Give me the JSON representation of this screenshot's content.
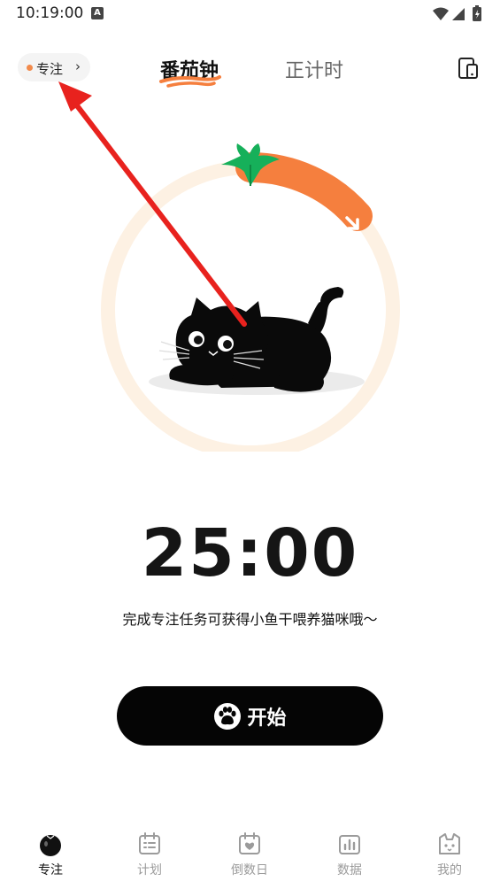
{
  "status": {
    "time": "10:19:00",
    "notice_letter": "A"
  },
  "header": {
    "focus_chip": "专注",
    "tabs": [
      {
        "label": "番茄钟",
        "active": true
      },
      {
        "label": "正计时",
        "active": false
      }
    ]
  },
  "timer": {
    "value": "25:00",
    "hint": "完成专注任务可获得小鱼干喂养猫咪哦～",
    "progress_fraction": 0.18
  },
  "actions": {
    "start_label": "开始"
  },
  "bottom_nav": [
    {
      "label": "专注",
      "icon": "tomato-icon",
      "active": true
    },
    {
      "label": "计划",
      "icon": "calendar-list-icon",
      "active": false
    },
    {
      "label": "倒数日",
      "icon": "calendar-heart-icon",
      "active": false
    },
    {
      "label": "数据",
      "icon": "bar-chart-icon",
      "active": false
    },
    {
      "label": "我的",
      "icon": "cat-face-icon",
      "active": false
    }
  ],
  "colors": {
    "accent_orange": "#f57f3e",
    "ring_bg": "#fdf1e3",
    "leaf_green": "#16b05a",
    "button_black": "#050505"
  }
}
